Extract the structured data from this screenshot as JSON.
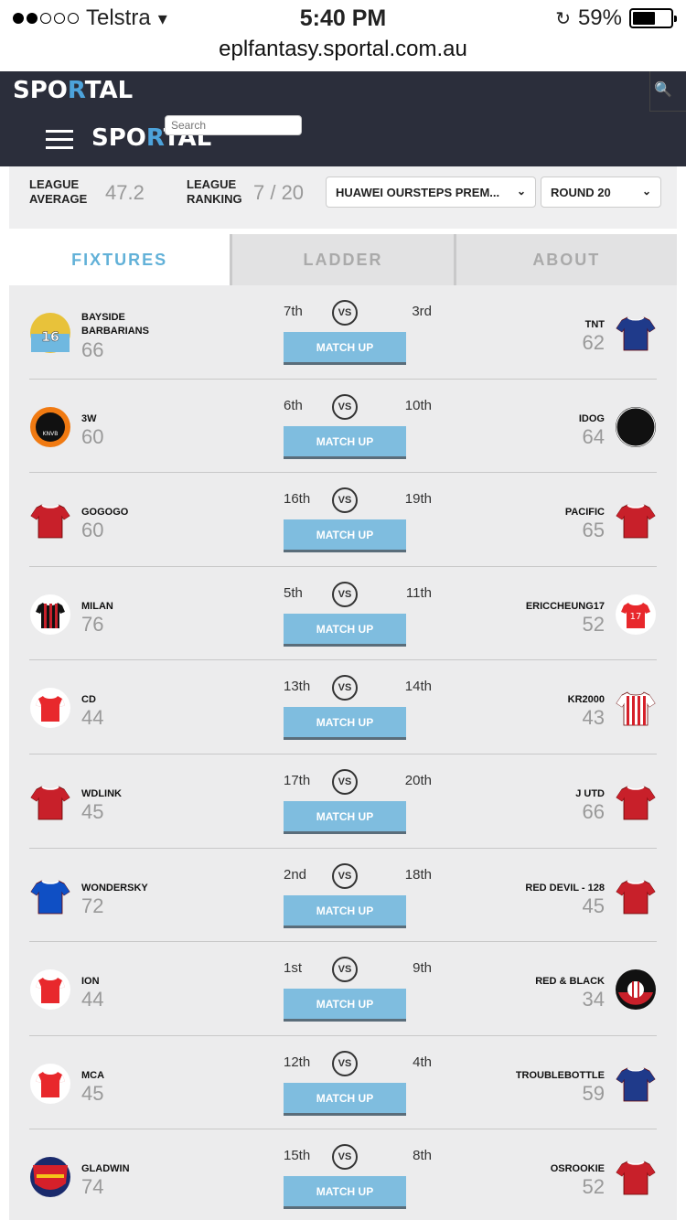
{
  "status": {
    "carrier": "Telstra",
    "time": "5:40 PM",
    "battery": "59%",
    "battery_level": 0.59,
    "signal_bars": 2
  },
  "browser": {
    "url": "eplfantasy.sportal.com.au"
  },
  "header": {
    "logo": "SPORTAL",
    "search_placeholder": "Search"
  },
  "league": {
    "average_label": "LEAGUE AVERAGE",
    "average_value": "47.2",
    "ranking_label": "LEAGUE RANKING",
    "ranking_value": "7 / 20",
    "league_select": "HUAWEI OURSTEPS PREM...",
    "round_select": "ROUND 20"
  },
  "tabs": [
    {
      "label": "FIXTURES",
      "active": true
    },
    {
      "label": "LADDER",
      "active": false
    },
    {
      "label": "ABOUT",
      "active": false
    }
  ],
  "matchup_label": "MATCH UP",
  "vs_label": "VS",
  "fixtures": [
    {
      "home": "BAYSIDE BARBARIANS",
      "home_score": "66",
      "home_rank": "7th",
      "away": "TNT",
      "away_score": "62",
      "away_rank": "3rd",
      "home_kit": "badge-16",
      "away_kit": "navy-shirt"
    },
    {
      "home": "3W",
      "home_score": "60",
      "home_rank": "6th",
      "away": "IDOG",
      "away_score": "64",
      "away_rank": "10th",
      "home_kit": "knvb-badge",
      "away_kit": "idog-badge"
    },
    {
      "home": "GOGOGO",
      "home_score": "60",
      "home_rank": "16th",
      "away": "PACIFIC",
      "away_score": "65",
      "away_rank": "19th",
      "home_kit": "red-shirt",
      "away_kit": "red-shirt"
    },
    {
      "home": "MILAN",
      "home_score": "76",
      "home_rank": "5th",
      "away": "ERICCHEUNG17",
      "away_score": "52",
      "away_rank": "11th",
      "home_kit": "milan-shirt",
      "away_kit": "red-17-shirt"
    },
    {
      "home": "CD",
      "home_score": "44",
      "home_rank": "13th",
      "away": "KR2000",
      "away_score": "43",
      "away_rank": "14th",
      "home_kit": "red-white-shirt",
      "away_kit": "striped-shirt"
    },
    {
      "home": "WDLINK",
      "home_score": "45",
      "home_rank": "17th",
      "away": "J UTD",
      "away_score": "66",
      "away_rank": "20th",
      "home_kit": "red-shirt",
      "away_kit": "red-shirt"
    },
    {
      "home": "WONDERSKY",
      "home_score": "72",
      "home_rank": "2nd",
      "away": "RED DEVIL - 128",
      "away_score": "45",
      "away_rank": "18th",
      "home_kit": "blue-shirt",
      "away_kit": "red-shirt"
    },
    {
      "home": "ION",
      "home_score": "44",
      "home_rank": "1st",
      "away": "RED & BLACK",
      "away_score": "34",
      "away_rank": "9th",
      "home_kit": "red-white-shirt",
      "away_kit": "milan-badge"
    },
    {
      "home": "MCA",
      "home_score": "45",
      "home_rank": "12th",
      "away": "TROUBLEBOTTLE",
      "away_score": "59",
      "away_rank": "4th",
      "home_kit": "red-white-shirt",
      "away_kit": "navy-shirt"
    },
    {
      "home": "GLADWIN",
      "home_score": "74",
      "home_rank": "15th",
      "away": "OSROOKIE",
      "away_score": "52",
      "away_rank": "8th",
      "home_kit": "arsenal-badge",
      "away_kit": "red-shirt"
    }
  ],
  "colors": {
    "header_bg": "#2b2e3b",
    "accent": "#62b1d8",
    "button": "#7fbddf",
    "red_kit": "#c8202a",
    "navy_kit": "#1f3a8a"
  }
}
